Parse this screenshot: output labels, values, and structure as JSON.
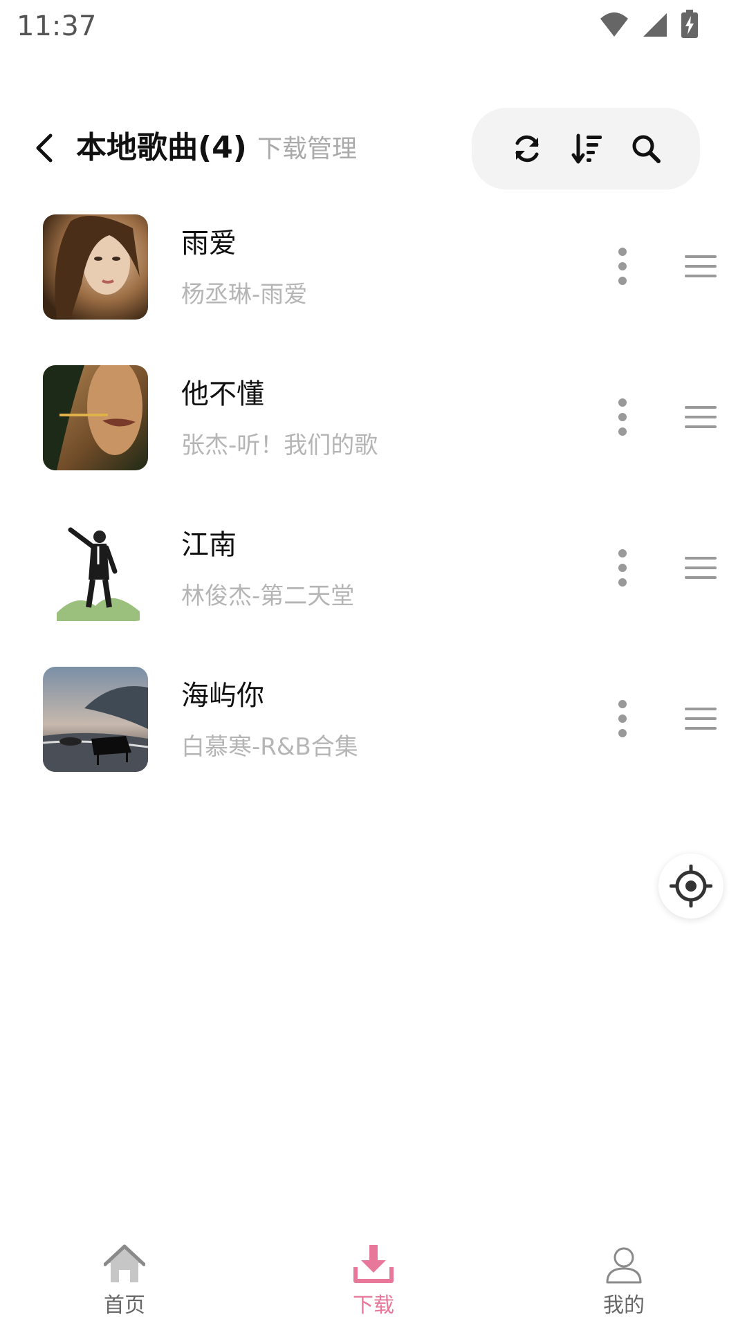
{
  "status_bar": {
    "time": "11:37"
  },
  "header": {
    "title": "本地歌曲(4)",
    "download_manage": "下载管理",
    "toolbar": {
      "refresh_icon": "refresh-icon",
      "sort_icon": "sort-icon",
      "search_icon": "search-icon"
    }
  },
  "songs": [
    {
      "title": "雨爱",
      "subtitle": "杨丞琳-雨爱"
    },
    {
      "title": "他不懂",
      "subtitle": "张杰-听！我们的歌"
    },
    {
      "title": "江南",
      "subtitle": "林俊杰-第二天堂"
    },
    {
      "title": "海屿你",
      "subtitle": "白慕寒-R&B合集"
    }
  ],
  "bottom_nav": {
    "items": [
      {
        "label": "首页",
        "icon": "home-icon"
      },
      {
        "label": "下载",
        "icon": "download-icon",
        "active": true
      },
      {
        "label": "我的",
        "icon": "profile-icon"
      }
    ]
  },
  "colors": {
    "accent": "#e8789a",
    "toolbar_bg": "#f3f3f4",
    "subtitle": "#b5b5b5"
  }
}
